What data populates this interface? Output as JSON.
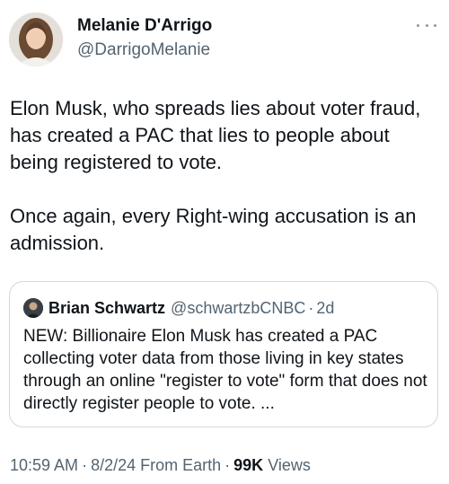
{
  "author": {
    "name": "Melanie D'Arrigo",
    "handle": "@DarrigoMelanie",
    "more_icon": "more-horizontal-icon"
  },
  "tweet": {
    "paragraphs": [
      "Elon Musk, who spreads lies about voter fraud, has created a PAC that lies to people about being registered to vote.",
      "Once again, every Right-wing accusation is an admission."
    ]
  },
  "quoted_tweet": {
    "name": "Brian Schwartz",
    "handle": "@schwartzbCNBC",
    "separator": "·",
    "time": "2d",
    "text": "NEW: Billionaire Elon Musk has created a PAC collecting voter data from those living in key states through an online \"register to vote\" form that does not directly register people to vote. ..."
  },
  "meta": {
    "time": "10:59 AM",
    "date": "8/2/24",
    "source": "From Earth",
    "views_count": "99K",
    "views_label": "Views",
    "separator": "·"
  }
}
